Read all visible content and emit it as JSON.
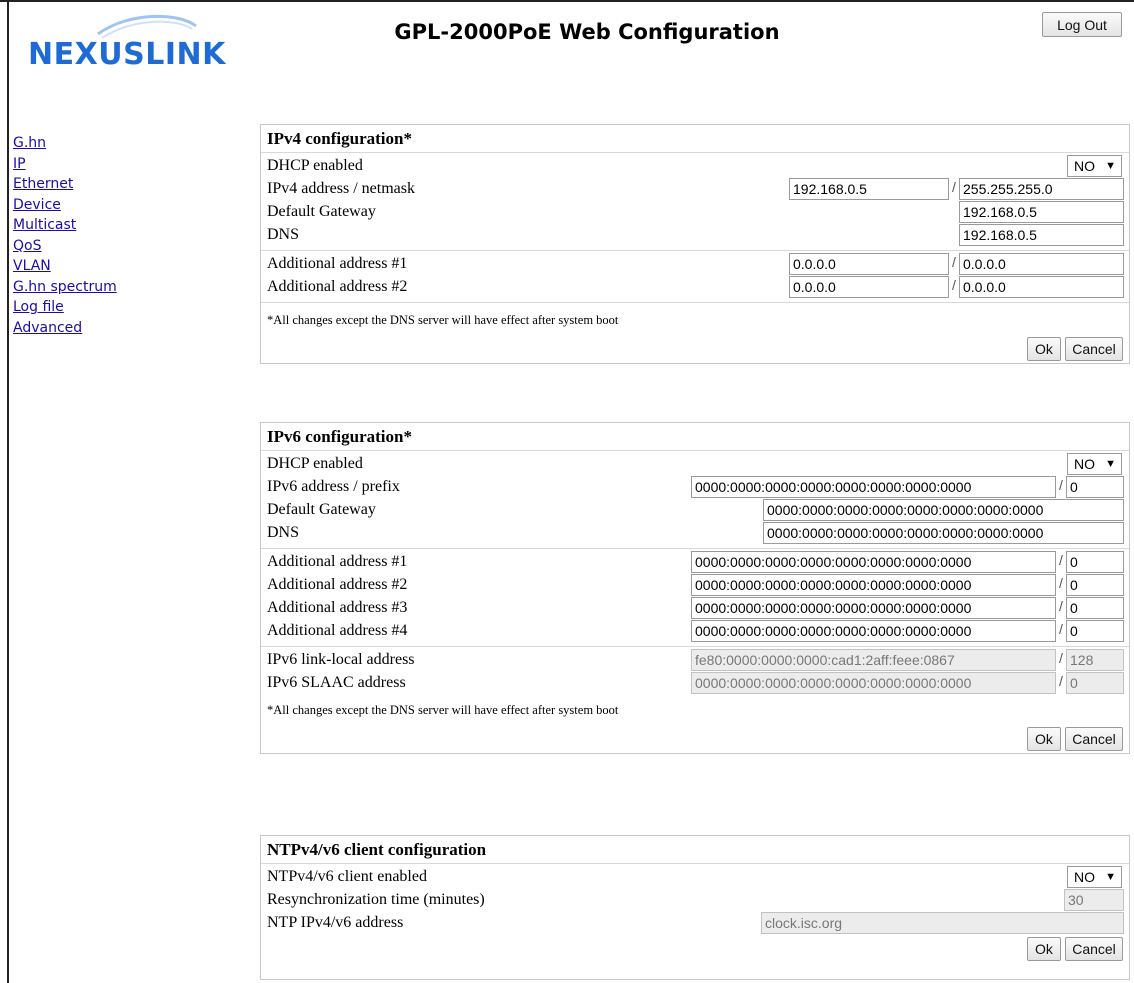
{
  "header": {
    "brand": "NEXUSLINK",
    "title": "GPL-2000PoE Web Configuration",
    "logout_label": "Log Out"
  },
  "nav": [
    "G.hn",
    "IP",
    "Ethernet",
    "Device",
    "Multicast",
    "QoS",
    "VLAN",
    "G.hn spectrum",
    "Log file",
    "Advanced"
  ],
  "ipv4": {
    "title": "IPv4 configuration*",
    "dhcp_label": "DHCP enabled",
    "dhcp_value": "NO",
    "addr_label": "IPv4 address / netmask",
    "addr": "192.168.0.5",
    "netmask": "255.255.255.0",
    "gw_label": "Default Gateway",
    "gw": "192.168.0.5",
    "dns_label": "DNS",
    "dns": "192.168.0.5",
    "add1_label": "Additional address #1",
    "add1_addr": "0.0.0.0",
    "add1_mask": "0.0.0.0",
    "add2_label": "Additional address #2",
    "add2_addr": "0.0.0.0",
    "add2_mask": "0.0.0.0",
    "note": "*All changes except the DNS server will have effect after system boot",
    "ok": "Ok",
    "cancel": "Cancel"
  },
  "ipv6": {
    "title": "IPv6 configuration*",
    "dhcp_label": "DHCP enabled",
    "dhcp_value": "NO",
    "addr_label": "IPv6 address / prefix",
    "addr": "0000:0000:0000:0000:0000:0000:0000:0000",
    "prefix": "0",
    "gw_label": "Default Gateway",
    "gw": "0000:0000:0000:0000:0000:0000:0000:0000",
    "dns_label": "DNS",
    "dns": "0000:0000:0000:0000:0000:0000:0000:0000",
    "additional": [
      {
        "label": "Additional address #1",
        "addr": "0000:0000:0000:0000:0000:0000:0000:0000",
        "prefix": "0"
      },
      {
        "label": "Additional address #2",
        "addr": "0000:0000:0000:0000:0000:0000:0000:0000",
        "prefix": "0"
      },
      {
        "label": "Additional address #3",
        "addr": "0000:0000:0000:0000:0000:0000:0000:0000",
        "prefix": "0"
      },
      {
        "label": "Additional address #4",
        "addr": "0000:0000:0000:0000:0000:0000:0000:0000",
        "prefix": "0"
      }
    ],
    "linklocal_label": "IPv6 link-local address",
    "linklocal": "fe80:0000:0000:0000:cad1:2aff:feee:0867",
    "linklocal_prefix": "128",
    "slaac_label": "IPv6 SLAAC address",
    "slaac": "0000:0000:0000:0000:0000:0000:0000:0000",
    "slaac_prefix": "0",
    "note": "*All changes except the DNS server will have effect after system boot",
    "ok": "Ok",
    "cancel": "Cancel"
  },
  "ntp": {
    "title": "NTPv4/v6 client configuration",
    "enabled_label": "NTPv4/v6 client enabled",
    "enabled_value": "NO",
    "resync_label": "Resynchronization time (minutes)",
    "resync": "30",
    "addr_label": "NTP IPv4/v6 address",
    "addr": "clock.isc.org",
    "ok": "Ok",
    "cancel": "Cancel"
  },
  "colors": {
    "logo_blue": "#1e6bd6",
    "logo_swoosh": "#9fc4ee",
    "link": "#1a0dab"
  }
}
